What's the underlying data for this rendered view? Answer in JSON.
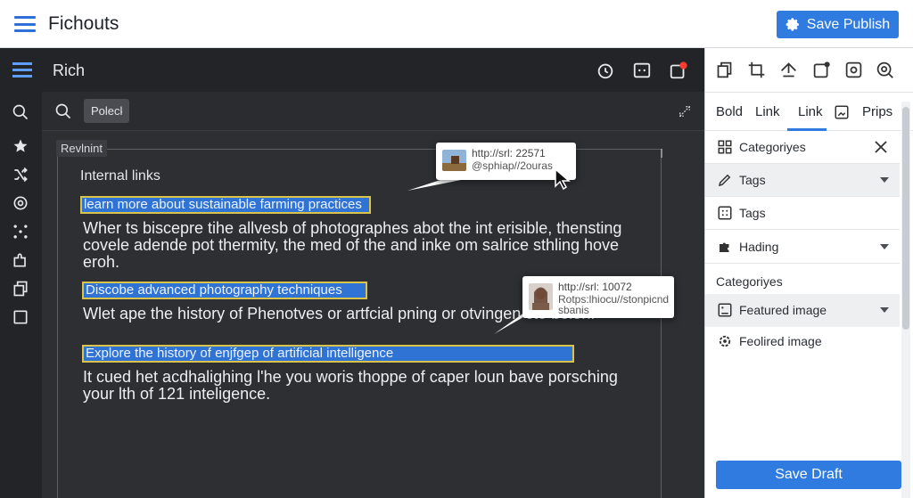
{
  "app": {
    "title": "Fichouts",
    "publish_label": "Save Publish"
  },
  "editor_header": {
    "title": "Rich"
  },
  "search": {
    "value": "Poleck"
  },
  "editor": {
    "tag_label": "Revlnint",
    "section_title": "Internal links",
    "highlights": [
      "learn more about sustainable farming practices",
      "Discobe advanced photography techniques",
      "Explore the history of enjfgep of artificial intelligence"
    ],
    "paragraphs": [
      [
        "Wher ts biscepre tihe allvesb of photographes abot the int erisible, thensting",
        "covele adende pot  thermity, the med of the and inke om salrice sthling hove",
        "eroh."
      ],
      [
        "Wlet ape the history of  Phenotves or artfcial pning or otvingen cto bolen."
      ],
      [
        "It cued het acdhalighing l'he you woris thoppe of caper loun bave porsching",
        "your lth of  121 inteligence."
      ]
    ]
  },
  "tooltips": [
    {
      "url": "http://srl: 22571",
      "sub": "@sphiap//2ouras"
    },
    {
      "url": "http://srl: 10072",
      "sub": "Rotps:lhiocu//stonpicnd",
      "sub2": "sbanis"
    }
  ],
  "right_panel": {
    "tabs": [
      "Bold",
      "Link",
      "Link",
      "Prips"
    ],
    "rows": [
      {
        "label": "Categoriyes",
        "control": "close"
      },
      {
        "label": "Tags",
        "control": "caret"
      },
      {
        "label": "Tags",
        "control": "none"
      },
      {
        "label": "Hading",
        "control": "caret"
      }
    ],
    "section_label": "Categoriyes",
    "rows2": [
      {
        "label": "Featured image",
        "control": "caret"
      },
      {
        "label": "Feolired image",
        "control": "none"
      }
    ],
    "save_draft_label": "Save Draft"
  },
  "colors": {
    "accent": "#2f7be0",
    "highlight": "#2f73d4",
    "highlight_border": "#d9c34a",
    "dark_bg": "#2d2f33"
  }
}
